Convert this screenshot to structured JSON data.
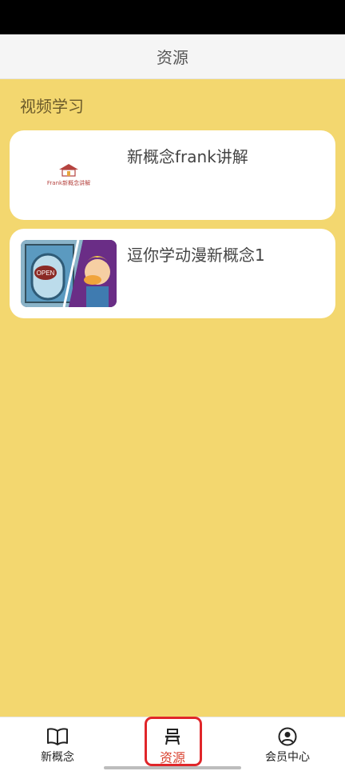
{
  "header": {
    "title": "资源"
  },
  "section": {
    "title": "视频学习"
  },
  "cards": [
    {
      "title": "新概念frank讲解",
      "thumb_icon": "frank-logo-thumbnail",
      "thumb_text": "Frank新概念讲解"
    },
    {
      "title": "逗你学动漫新概念1",
      "thumb_icon": "cartoon-thumbnail",
      "thumb_text": "OPEN"
    }
  ],
  "nav": {
    "items": [
      {
        "label": "新概念",
        "icon": "book-icon",
        "active": false
      },
      {
        "label": "资源",
        "icon": "desk-icon",
        "active": true
      },
      {
        "label": "会员中心",
        "icon": "user-circle-icon",
        "active": false
      }
    ],
    "active_color": "#d9412f"
  },
  "colors": {
    "background": "#f3d76f",
    "card": "#ffffff",
    "highlight": "#e0262a"
  }
}
